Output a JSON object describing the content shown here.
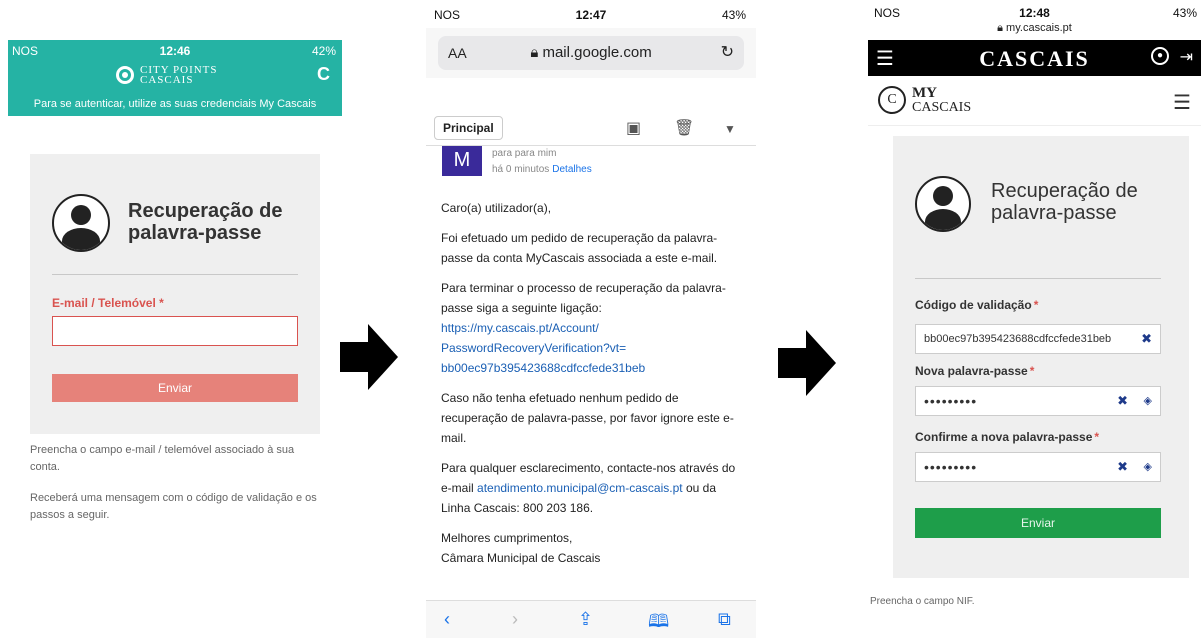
{
  "screen1": {
    "status": {
      "carrier": "NOS",
      "time": "12:46",
      "battery": "42%"
    },
    "header": {
      "logo_line1": "CITY POINTS",
      "logo_line2": "CASCAIS",
      "note": "Para se autenticar, utilize as suas credenciais My Cascais"
    },
    "title": "Recuperação de palavra-passe",
    "field_label": "E-mail / Telemóvel",
    "required_mark": "*",
    "submit": "Enviar",
    "help1": "Preencha o campo e-mail / telemóvel associado à sua conta.",
    "help2": "Receberá uma mensagem com o código de validação e os passos a seguir."
  },
  "screen2": {
    "status": {
      "carrier": "NOS",
      "time": "12:47",
      "battery": "43%"
    },
    "url_aa": "AA",
    "url": "mail.google.com",
    "folder": "Principal",
    "sender_initial": "M",
    "to": "para para mim",
    "time_ago": "há 0 minutos",
    "details": "Detalhes",
    "greeting": "Caro(a) utilizador(a),",
    "p1": "Foi efetuado um pedido de recuperação da palavra-passe da conta MyCascais associada a este e-mail.",
    "p2": "Para terminar o processo de recuperação da palavra-passe siga a seguinte ligação:",
    "link1": "https://my.cascais.pt/Account/",
    "link2": "PasswordRecoveryVerification?vt=",
    "link3": "bb00ec97b395423688cdfccfede31beb",
    "p3": "Caso não tenha efetuado nenhum pedido de recuperação de palavra-passe, por favor ignore este e-mail.",
    "p4a": "Para qualquer esclarecimento, contacte-nos através do e-mail",
    "p4_email": "atendimento.municipal@cm-cascais.pt",
    "p4b": "ou da Linha Cascais: 800 203 186.",
    "sign1": "Melhores cumprimentos,",
    "sign2": "Câmara Municipal de Cascais"
  },
  "screen3": {
    "status": {
      "carrier": "NOS",
      "time": "12:48",
      "battery": "43%"
    },
    "url": "my.cascais.pt",
    "brand": "CASCAIS",
    "logo_my": "MY",
    "logo_cascais": "CASCAIS",
    "title": "Recuperação de palavra-passe",
    "code_label": "Código de validação",
    "code_value": "bb00ec97b395423688cdfccfede31beb",
    "new_pw_label": "Nova palavra-passe",
    "new_pw_value": "•••••••••",
    "confirm_label": "Confirme a nova palavra-passe",
    "confirm_value": "•••••••••",
    "required_mark": "*",
    "submit": "Enviar",
    "help": "Preencha o campo NIF."
  },
  "colors": {
    "teal_header": "#25b3a4",
    "error_red": "#d9534f",
    "submit_disabled": "#e6827a",
    "submit_green": "#1e9e4a"
  }
}
